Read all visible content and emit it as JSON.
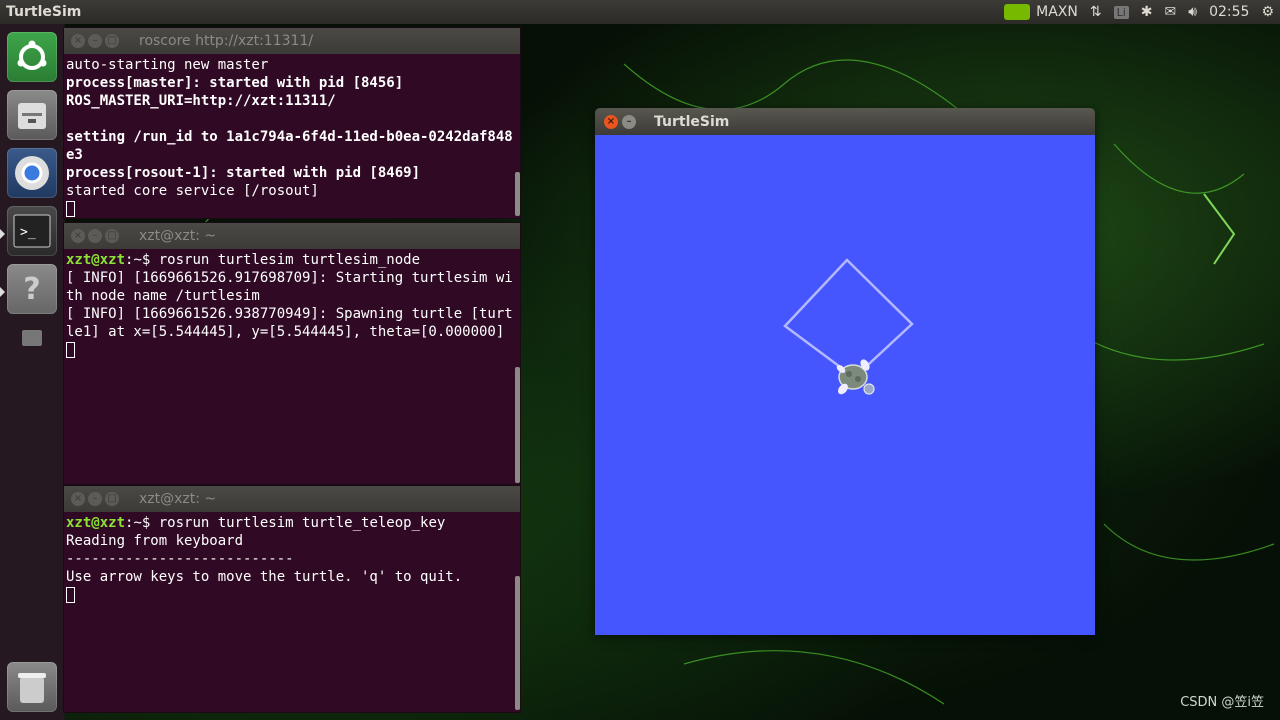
{
  "top_panel": {
    "app_title": "TurtleSim",
    "power_mode": "MAXN",
    "keyboard_layout": "Li",
    "clock": "02:55",
    "icons": [
      "nvidia-icon",
      "network-icon",
      "keyboard-icon",
      "bluetooth-icon",
      "mail-icon",
      "volume-icon",
      "gear-icon"
    ]
  },
  "launcher": {
    "items": [
      "ubuntu-dash",
      "files",
      "chromium",
      "terminal",
      "help",
      "trash"
    ]
  },
  "terminals": [
    {
      "title": "roscore http://xzt:11311/",
      "lines": [
        {
          "text": "auto-starting new master",
          "bold": false
        },
        {
          "text": "process[master]: started with pid [8456]",
          "bold": true
        },
        {
          "text": "ROS_MASTER_URI=http://xzt:11311/",
          "bold": true
        },
        {
          "text": "",
          "bold": false
        },
        {
          "text": "setting /run_id to 1a1c794a-6f4d-11ed-b0ea-0242daf848e3",
          "bold": true
        },
        {
          "text": "process[rosout-1]: started with pid [8469]",
          "bold": true
        },
        {
          "text": "started core service [/rosout]",
          "bold": false
        }
      ]
    },
    {
      "title": "xzt@xzt: ~",
      "prompt": "xzt@xzt",
      "prompt_suffix": ":~$ ",
      "command": "rosrun turtlesim turtlesim_node",
      "lines": [
        {
          "text": "[ INFO] [1669661526.917698709]: Starting turtlesim with node name /turtlesim",
          "bold": false
        },
        {
          "text": "[ INFO] [1669661526.938770949]: Spawning turtle [turtle1] at x=[5.544445], y=[5.544445], theta=[0.000000]",
          "bold": false
        }
      ]
    },
    {
      "title": "xzt@xzt: ~",
      "prompt": "xzt@xzt",
      "prompt_suffix": ":~$ ",
      "command": "rosrun turtlesim turtle_teleop_key",
      "lines": [
        {
          "text": "Reading from keyboard",
          "bold": false
        },
        {
          "text": "---------------------------",
          "bold": false
        },
        {
          "text": "Use arrow keys to move the turtle. 'q' to quit.",
          "bold": false
        }
      ]
    }
  ],
  "turtlesim": {
    "title": "TurtleSim",
    "background_color": "#4556ff",
    "path_color": "#b3b8ff"
  },
  "watermark": "CSDN @笠i笠"
}
